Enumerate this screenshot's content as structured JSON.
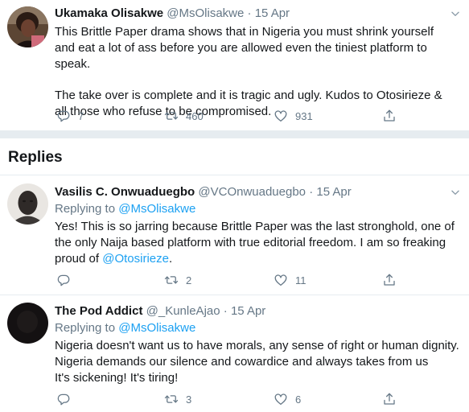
{
  "main_tweet": {
    "name": "Ukamaka Olisakwe",
    "handle": "@MsOlisakwe",
    "date": "15 Apr",
    "paragraphs": [
      "This Brittle Paper drama shows that in Nigeria you must shrink yourself and eat a lot of ass before you are allowed even the tiniest platform to speak.",
      "The take over is complete and it is tragic and ugly. Kudos to Otosirieze & all those who refuse to be compromised."
    ],
    "reply_count": "7",
    "retweet_count": "460",
    "like_count": "931"
  },
  "replies_header": "Replies",
  "replies": [
    {
      "name": "Vasilis C. Onwuaduegbo",
      "handle": "@VCOnwuaduegbo",
      "date": "15 Apr",
      "replying_label": "Replying to",
      "replying_to": "@MsOlisakwe",
      "text": "Yes! This is so jarring because Brittle Paper was the last stronghold, one of the only Naija based platform with true editorial freedom. I am so freaking proud of",
      "mention": "@Otosirieze",
      "text_end": ".",
      "reply_count": "",
      "retweet_count": "2",
      "like_count": "11"
    },
    {
      "name": "The Pod Addict",
      "handle": "@_KunleAjao",
      "date": "15 Apr",
      "replying_label": "Replying to",
      "replying_to": "@MsOlisakwe",
      "lines": [
        "Nigeria doesn't want us to have morals, any sense of right or human dignity.",
        "Nigeria demands our silence and cowardice and always takes from us",
        "It's sickening! It's tiring!"
      ],
      "reply_count": "",
      "retweet_count": "3",
      "like_count": "6"
    }
  ],
  "icons": {
    "reply": "reply-icon",
    "retweet": "retweet-icon",
    "like": "heart-icon",
    "share": "share-icon",
    "more": "chevron-down-icon"
  },
  "colors": {
    "link": "#1da1f2",
    "muted": "#657786",
    "text": "#14171a",
    "divider": "#e6ecf0"
  }
}
